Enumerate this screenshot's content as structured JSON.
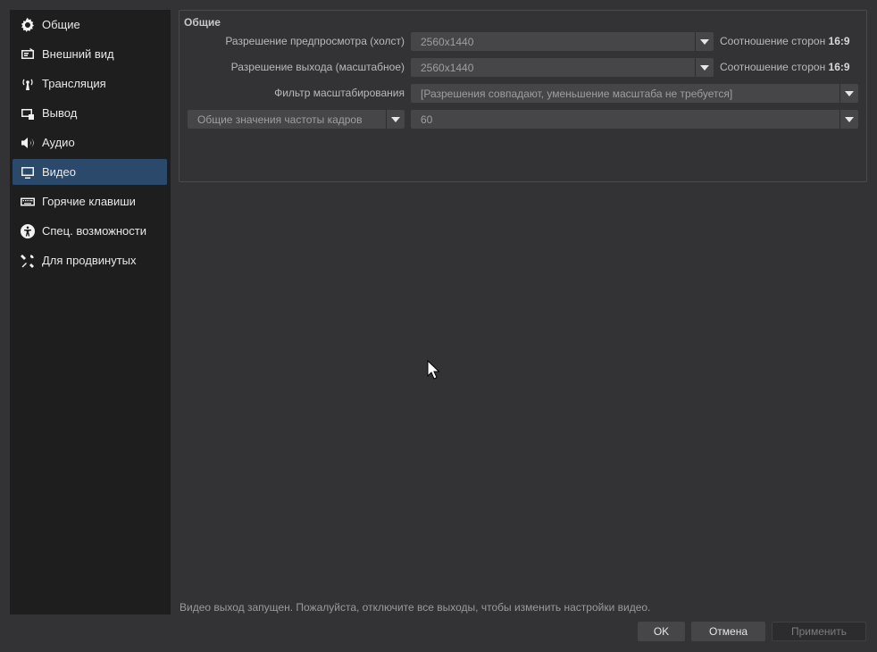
{
  "sidebar": {
    "items": [
      {
        "label": "Общие",
        "icon": "gear-icon"
      },
      {
        "label": "Внешний вид",
        "icon": "appearance-icon"
      },
      {
        "label": "Трансляция",
        "icon": "broadcast-icon"
      },
      {
        "label": "Вывод",
        "icon": "output-icon"
      },
      {
        "label": "Аудио",
        "icon": "speaker-icon"
      },
      {
        "label": "Видео",
        "icon": "monitor-icon",
        "active": true
      },
      {
        "label": "Горячие клавиши",
        "icon": "keyboard-icon"
      },
      {
        "label": "Спец. возможности",
        "icon": "accessibility-icon"
      },
      {
        "label": "Для продвинутых",
        "icon": "tools-icon"
      }
    ]
  },
  "general": {
    "title": "Общие",
    "base_resolution_label": "Разрешение предпросмотра (холст)",
    "base_resolution_value": "2560x1440",
    "base_aspect_prefix": "Соотношение сторон",
    "base_aspect_value": "16:9",
    "output_resolution_label": "Разрешение выхода (масштабное)",
    "output_resolution_value": "2560x1440",
    "output_aspect_prefix": "Соотношение сторон",
    "output_aspect_value": "16:9",
    "filter_label": "Фильтр масштабирования",
    "filter_value": "[Разрешения совпадают, уменьшение масштаба не требуется]",
    "fps_type_value": "Общие значения частоты кадров",
    "fps_value": "60"
  },
  "status_message": "Видео выход запущен. Пожалуйста, отключите все выходы, чтобы изменить настройки видео.",
  "buttons": {
    "ok": "OK",
    "cancel": "Отмена",
    "apply": "Применить"
  },
  "colors": {
    "background": "#333335",
    "sidebar": "#1e1e1f",
    "active_item": "#2b4a6b",
    "combo": "#464648"
  }
}
